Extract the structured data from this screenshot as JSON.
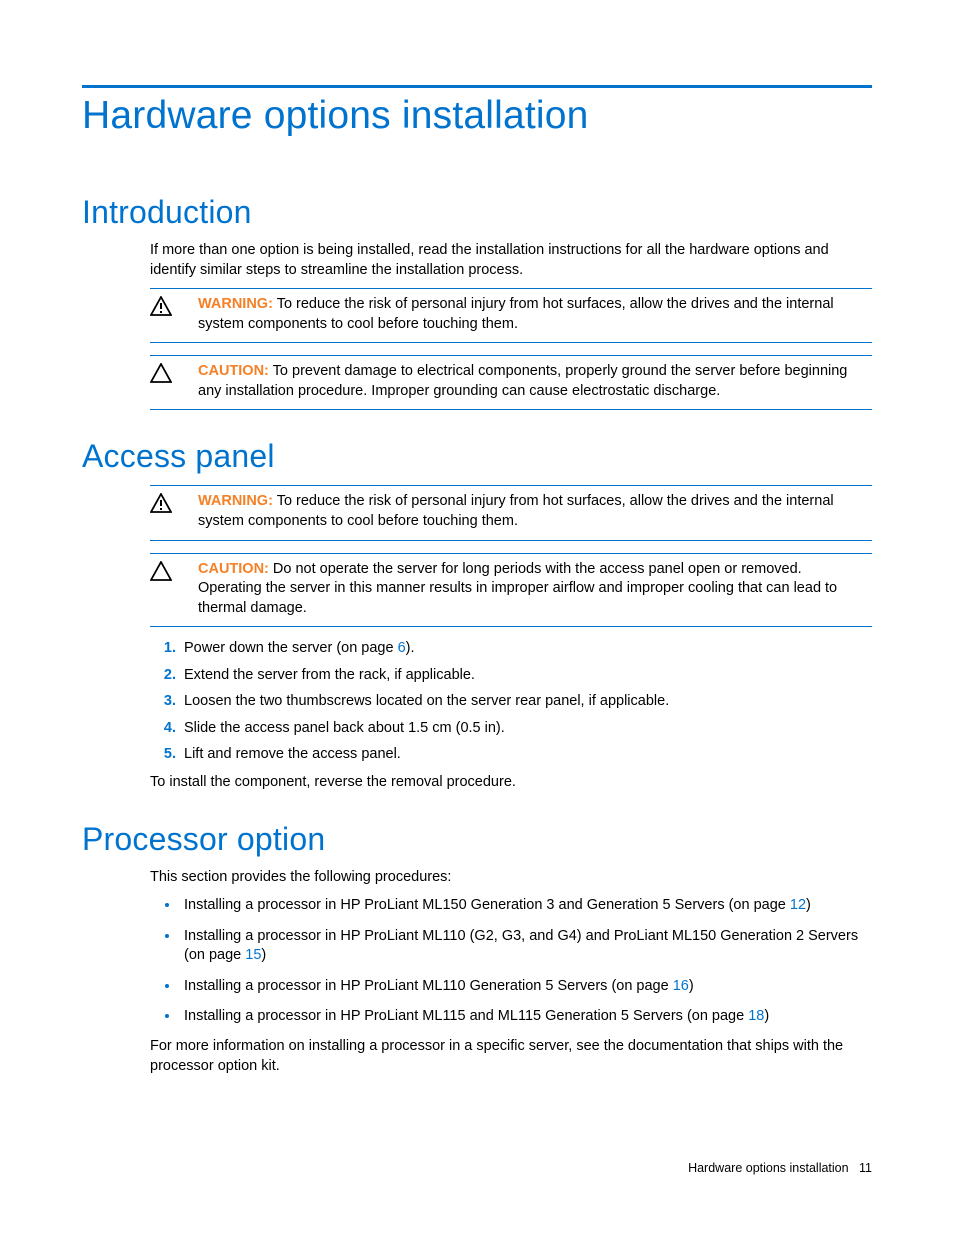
{
  "page_title": "Hardware options installation",
  "sections": {
    "intro": {
      "heading": "Introduction",
      "para": "If more than one option is being installed, read the installation instructions for all the hardware options and identify similar steps to streamline the installation process.",
      "warn_label": "WARNING:",
      "warn_text": "  To reduce the risk of personal injury from hot surfaces, allow the drives and the internal system components to cool before touching them.",
      "caution_label": "CAUTION:",
      "caution_text": "  To prevent damage to electrical components, properly ground the server before beginning any installation procedure. Improper grounding can cause electrostatic discharge."
    },
    "access": {
      "heading": "Access panel",
      "warn_label": "WARNING:",
      "warn_text": "  To reduce the risk of personal injury from hot surfaces, allow the drives and the internal system components to cool before touching them.",
      "caution_label": "CAUTION:",
      "caution_text": "  Do not operate the server for long periods with the access panel open or removed. Operating the server in this manner results in improper airflow and improper cooling that can lead to thermal damage.",
      "steps": {
        "s1a": "Power down the server (on page ",
        "s1link": "6",
        "s1b": ").",
        "s2": "Extend the server from the rack, if applicable.",
        "s3": "Loosen the two thumbscrews located on the server rear panel, if applicable.",
        "s4": "Slide the access panel back about 1.5 cm (0.5 in).",
        "s5": "Lift and remove the access panel."
      },
      "closing": "To install the component, reverse the removal procedure."
    },
    "processor": {
      "heading": "Processor option",
      "intro": "This section provides the following procedures:",
      "b1a": "Installing a processor in HP ProLiant ML150 Generation 3 and Generation 5 Servers (on page ",
      "b1link": "12",
      "b1b": ")",
      "b2a": "Installing a processor in HP ProLiant ML110 (G2, G3, and G4) and ProLiant ML150 Generation 2 Servers (on page ",
      "b2link": "15",
      "b2b": ")",
      "b3a": "Installing a processor in HP ProLiant ML110 Generation 5 Servers (on page ",
      "b3link": "16",
      "b3b": ")",
      "b4a": "Installing a processor in HP ProLiant ML115 and ML115 Generation 5 Servers (on page ",
      "b4link": "18",
      "b4b": ")",
      "closing": "For more information on installing a processor in a specific server, see the documentation that ships with the processor option kit."
    }
  },
  "footer": {
    "text": "Hardware options installation",
    "page": "11"
  }
}
